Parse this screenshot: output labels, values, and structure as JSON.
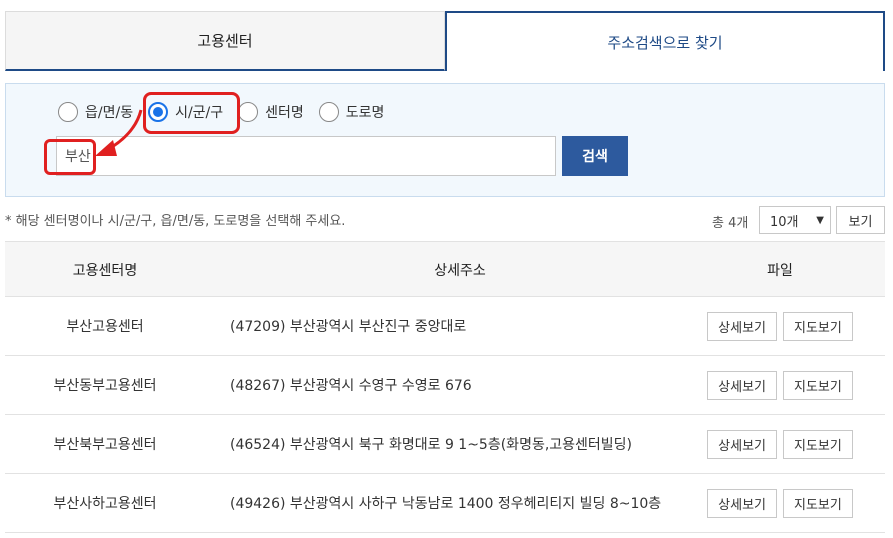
{
  "tabs": {
    "center": "고용센터",
    "address": "주소검색으로 찾기"
  },
  "search": {
    "options": [
      "읍/면/동",
      "시/군/구",
      "센터명",
      "도로명"
    ],
    "selected_index": 1,
    "query": "부산",
    "button": "검색"
  },
  "info": {
    "notice": "* 해당 센터명이나 시/군/구, 읍/면/동, 도로명을 선택해 주세요.",
    "total": "총 4개",
    "page_size": "10개",
    "view_button": "보기"
  },
  "table": {
    "headers": [
      "고용센터명",
      "상세주소",
      "파일"
    ],
    "detail_label": "상세보기",
    "map_label": "지도보기",
    "rows": [
      {
        "name": "부산고용센터",
        "address": "(47209) 부산광역시 부산진구 중앙대로"
      },
      {
        "name": "부산동부고용센터",
        "address": "(48267) 부산광역시 수영구 수영로 676"
      },
      {
        "name": "부산북부고용센터",
        "address": "(46524) 부산광역시 북구 화명대로 9 1~5층(화명동,고용센터빌딩)"
      },
      {
        "name": "부산사하고용센터",
        "address": "(49426) 부산광역시 사하구 낙동남로 1400 정우헤리티지 빌딩 8~10층"
      }
    ]
  },
  "colors": {
    "tab_accent": "#1e4a86",
    "search_button": "#2d5a9e",
    "highlight": "#e02020",
    "radio_checked": "#1a73e8"
  }
}
